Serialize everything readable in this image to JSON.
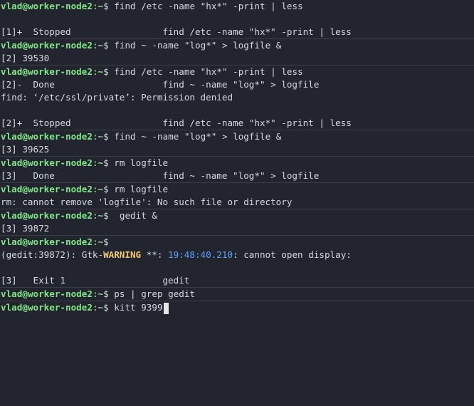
{
  "prompt": {
    "user": "vlad",
    "at": "@",
    "host": "worker-node2",
    "path": "~",
    "symbol": "$"
  },
  "blocks": [
    {
      "cmd": " find /etc -name \"hx*\" -print | less",
      "output": [
        "",
        "[1]+  Stopped                 find /etc -name \"hx*\" -print | less"
      ]
    },
    {
      "cmd": " find ~ -name \"log*\" > logfile &",
      "output": [
        "[2] 39530"
      ]
    },
    {
      "cmd": " find /etc -name \"hx*\" -print | less",
      "output": [
        "[2]-  Done                    find ~ -name \"log*\" > logfile",
        "find: ‘/etc/ssl/private’: Permission denied",
        "",
        "[2]+  Stopped                 find /etc -name \"hx*\" -print | less"
      ]
    },
    {
      "cmd": " find ~ -name \"log*\" > logfile &",
      "output": [
        "[3] 39625"
      ]
    },
    {
      "cmd": " rm logfile",
      "output": [
        "[3]   Done                    find ~ -name \"log*\" > logfile"
      ]
    },
    {
      "cmd": " rm logfile",
      "output": [
        "rm: cannot remove 'logfile': No such file or directory"
      ]
    },
    {
      "cmd": "  gedit &",
      "output": [
        "[3] 39872"
      ]
    },
    {
      "cmd": "",
      "warning": {
        "prefix": "(gedit:39872): Gtk-",
        "level": "WARNING",
        "mid": " **: ",
        "time": "19:48:40.210",
        "suffix": ": cannot open display:"
      },
      "output": [
        "",
        "[3]   Exit 1                  gedit"
      ]
    },
    {
      "cmd": " ps | grep gedit",
      "output": []
    },
    {
      "cmd": " kitt 9399",
      "output": [],
      "active": true
    }
  ],
  "colors": {
    "background": "#23252e",
    "prompt": "#7ee787",
    "warning": "#f2c96b",
    "timestamp": "#5aa2ff"
  }
}
